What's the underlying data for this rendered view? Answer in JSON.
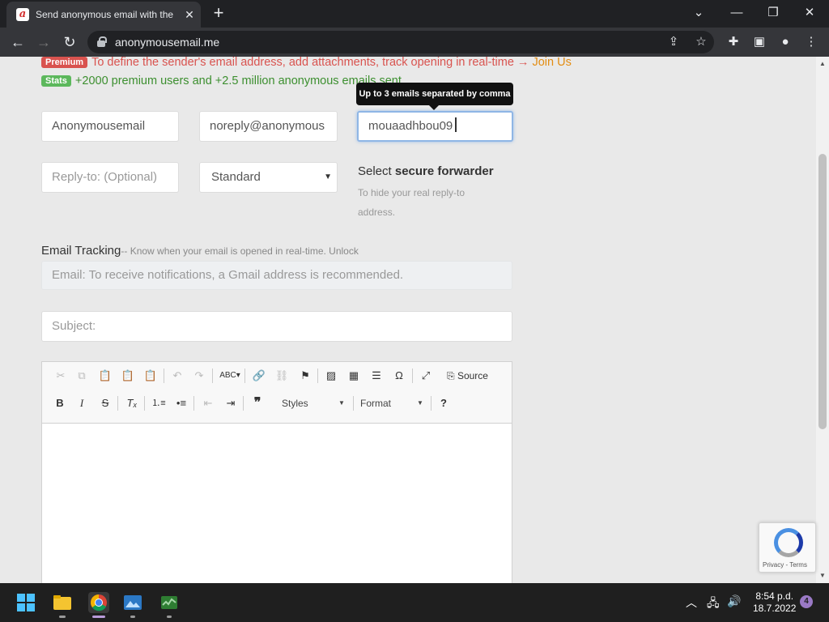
{
  "browser": {
    "tab_title": "Send anonymous email with the",
    "tab_close": "✕",
    "new_tab": "+",
    "url": "anonymousemail.me",
    "window_controls": {
      "dropdown": "⌄",
      "minimize": "—",
      "restore": "❐",
      "close": "✕"
    }
  },
  "promo": {
    "premium_badge": "Premium",
    "premium_text": "To define the sender's email address, add attachments, track opening in real-time → ",
    "premium_link": "Join Us",
    "stats_badge": "Stats",
    "stats_text": "+2000 premium users and +2.5 million anonymous emails sent"
  },
  "form": {
    "from_name": "Anonymousemail",
    "from_email": "noreply@anonymous",
    "to_value": "mouaadhbou09",
    "to_tooltip": "Up to 3 emails separated by comma",
    "reply_to_placeholder": "Reply-to: (Optional)",
    "forwarder_select": "Standard",
    "forwarder_title_prefix": "Select ",
    "forwarder_title_bold": "secure forwarder",
    "forwarder_desc": "To hide your real reply-to address.",
    "tracking_label": "Email Tracking",
    "tracking_sub": "-- Know when your email is opened in real-time. ",
    "tracking_unlock": "Unlock",
    "tracking_placeholder": "Email: To receive notifications, a Gmail address is recommended.",
    "subject_placeholder": "Subject:"
  },
  "editor": {
    "source_label": "Source",
    "styles_label": "Styles",
    "format_label": "Format"
  },
  "recaptcha": {
    "text": "Privacy - Terms"
  },
  "taskbar": {
    "time": "8:54 p.d.",
    "date": "18.7.2022",
    "notifications": "4"
  }
}
